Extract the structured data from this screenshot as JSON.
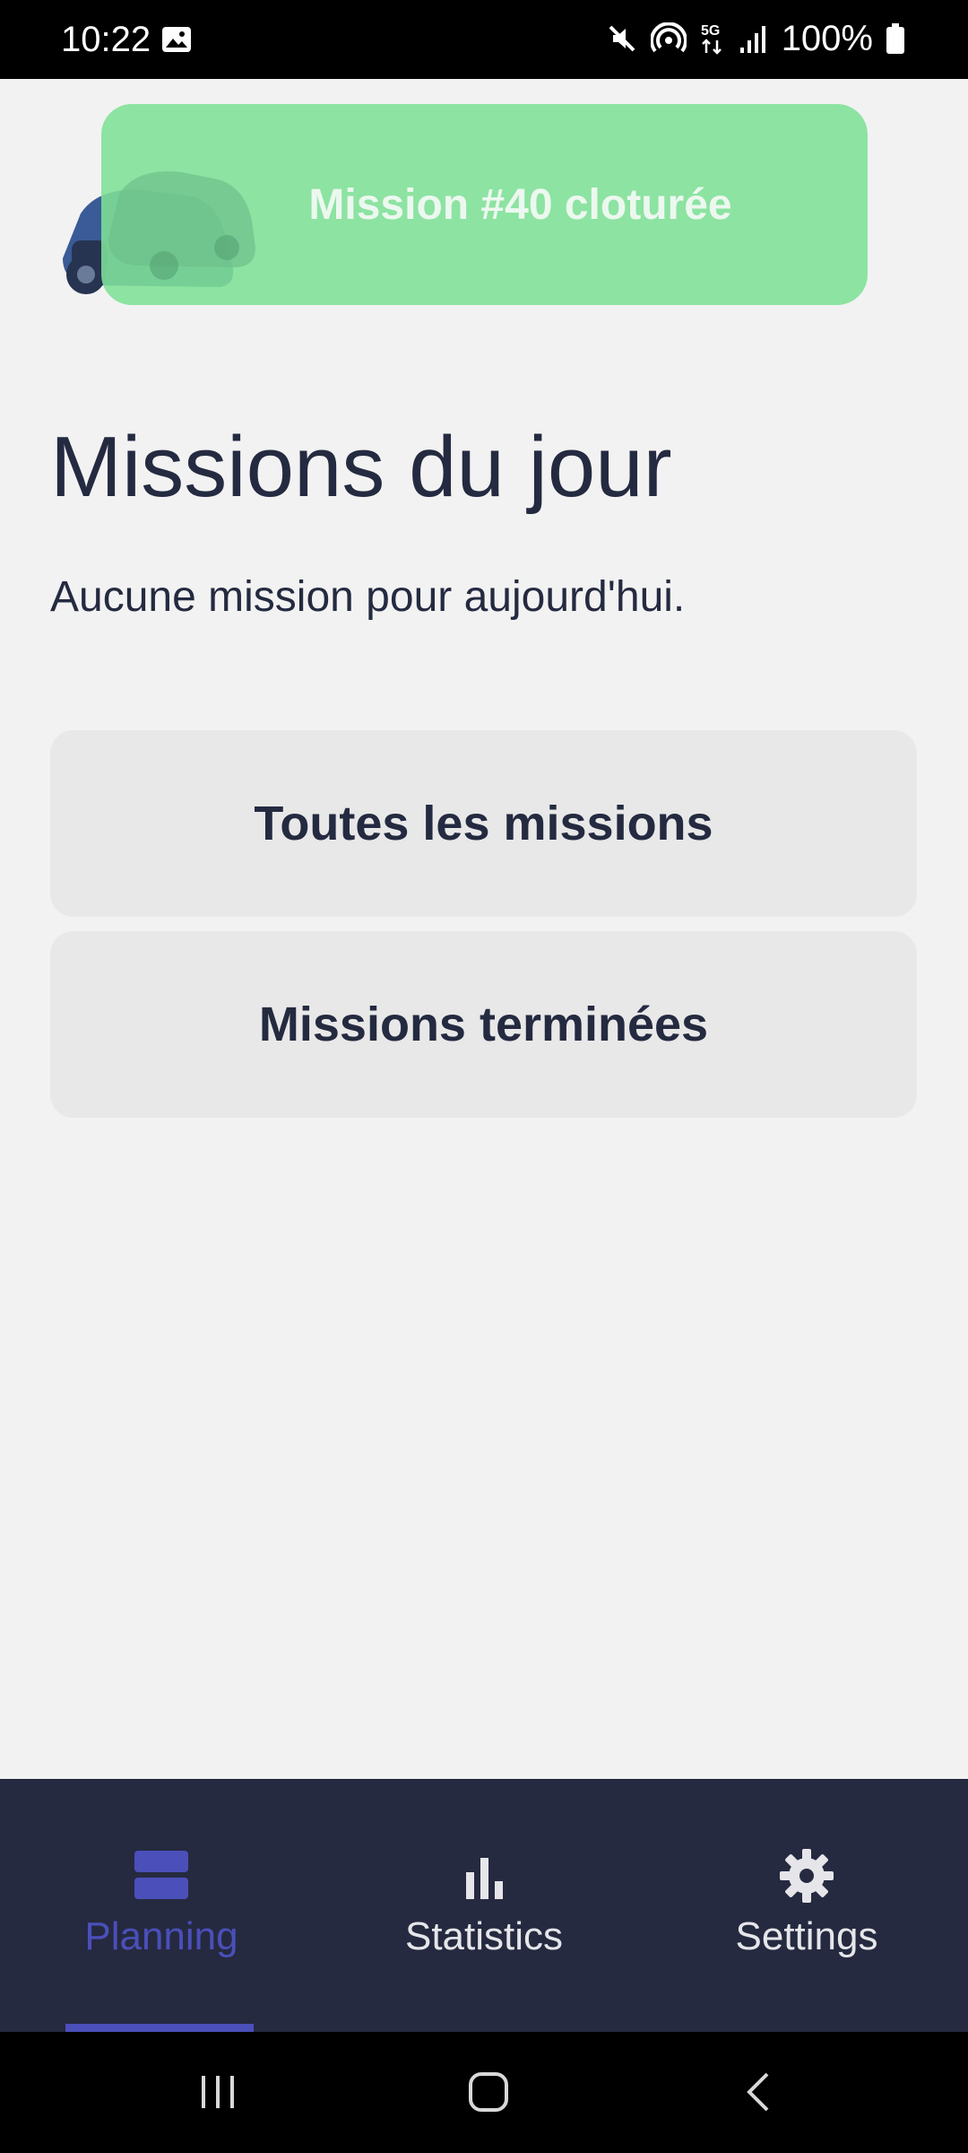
{
  "status_bar": {
    "time": "10:22",
    "battery_text": "100%",
    "icons": [
      "gallery-icon",
      "mute-icon",
      "hotspot-icon",
      "5g-icon",
      "signal-icon",
      "battery-icon"
    ]
  },
  "toast": {
    "message": "Mission #40 cloturée",
    "color": "#7ee096"
  },
  "main": {
    "title": "Missions du jour",
    "empty_message": "Aucune mission pour aujourd'hui.",
    "buttons": [
      {
        "label": "Toutes les missions"
      },
      {
        "label": "Missions terminées"
      }
    ]
  },
  "bottom_nav": {
    "items": [
      {
        "label": "Planning",
        "icon": "planning-icon",
        "active": true
      },
      {
        "label": "Statistics",
        "icon": "bar-chart-icon",
        "active": false
      },
      {
        "label": "Settings",
        "icon": "gear-icon",
        "active": false
      }
    ],
    "active_color": "#4b4fba",
    "background": "#252a40"
  },
  "system_nav": {
    "buttons": [
      "recents-icon",
      "home-icon",
      "back-icon"
    ]
  }
}
